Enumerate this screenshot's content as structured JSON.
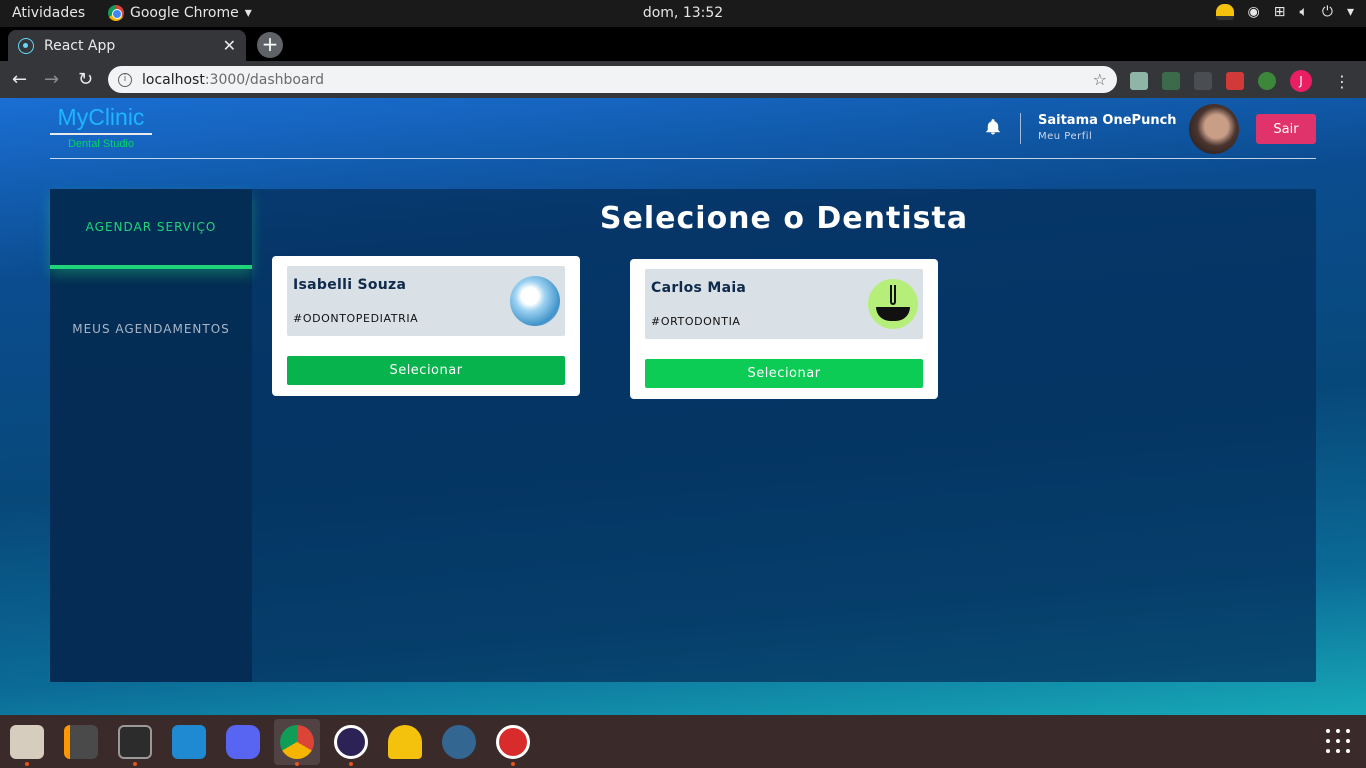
{
  "system_bar": {
    "activities": "Atividades",
    "app_name": "Google Chrome",
    "clock": "dom, 13:52"
  },
  "browser": {
    "tab_title": "React App",
    "url_host": "localhost",
    "url_path": ":3000/dashboard",
    "profile_initial": "J"
  },
  "header": {
    "brand": "MyClinic",
    "brand_sub": "Dental Studio",
    "user_name": "Saitama OnePunch",
    "user_link": "Meu Perfil",
    "logout": "Sair"
  },
  "sidebar": {
    "items": [
      {
        "label": "AGENDAR SERVIÇO",
        "active": true
      },
      {
        "label": "MEUS AGENDAMENTOS",
        "active": false
      }
    ]
  },
  "main": {
    "heading": "Selecione o Dentista",
    "dentists": [
      {
        "name": "Isabelli Souza",
        "specialty": "#ODONTOPEDIATRIA",
        "button": "Selecionar"
      },
      {
        "name": "Carlos Maia",
        "specialty": "#ORTODONTIA",
        "button": "Selecionar"
      }
    ]
  },
  "colors": {
    "accent_green": "#1ed47a",
    "button_green": "#06b34d",
    "logout_pink": "#e0336c",
    "brand_blue": "#1eb4ff"
  },
  "dock": {
    "apps": [
      "files-icon",
      "sublime-text-icon",
      "terminal-icon",
      "vscode-icon",
      "discord-icon",
      "chrome-icon",
      "eclipse-icon",
      "gnome-maps-icon",
      "postgres-icon",
      "app-icon"
    ]
  }
}
